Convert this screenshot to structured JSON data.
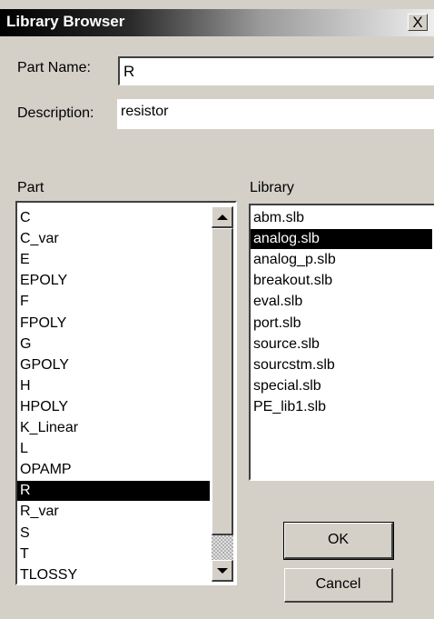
{
  "window": {
    "title": "Library Browser",
    "close_label": "X"
  },
  "fields": {
    "part_name_label": "Part Name:",
    "part_name_value": "R",
    "description_label": "Description:",
    "description_value": "resistor"
  },
  "part_list": {
    "header": "Part",
    "items": [
      "C",
      "C_var",
      "E",
      "EPOLY",
      "F",
      "FPOLY",
      "G",
      "GPOLY",
      "H",
      "HPOLY",
      "K_Linear",
      "L",
      "OPAMP",
      "R",
      "R_var",
      "S",
      "T",
      "TLOSSY"
    ],
    "selected": "R"
  },
  "library_list": {
    "header": "Library",
    "items": [
      "abm.slb",
      "analog.slb",
      "analog_p.slb",
      "breakout.slb",
      "eval.slb",
      "port.slb",
      "source.slb",
      "sourcstm.slb",
      "special.slb",
      "PE_lib1.slb"
    ],
    "selected": "analog.slb"
  },
  "buttons": {
    "ok": "OK",
    "cancel": "Cancel"
  },
  "icons": {
    "close": "close-icon",
    "scroll_up": "arrow-up-icon",
    "scroll_down": "arrow-down-icon"
  }
}
